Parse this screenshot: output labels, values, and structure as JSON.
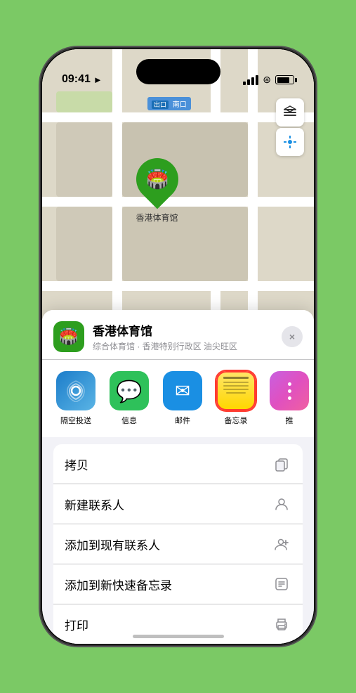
{
  "status_bar": {
    "time": "09:41",
    "location_arrow": "▶"
  },
  "map": {
    "label": "南口",
    "pin_label": "香港体育馆"
  },
  "venue": {
    "name": "香港体育馆",
    "subtitle": "综合体育馆 · 香港特别行政区 油尖旺区",
    "close_label": "×"
  },
  "share_items": [
    {
      "id": "airdrop",
      "label": "隔空投送",
      "icon": "📡"
    },
    {
      "id": "messages",
      "label": "信息",
      "icon": "💬"
    },
    {
      "id": "mail",
      "label": "邮件",
      "icon": "✉️"
    },
    {
      "id": "notes",
      "label": "备忘录",
      "icon": ""
    },
    {
      "id": "more",
      "label": "推",
      "icon": ""
    }
  ],
  "actions": [
    {
      "id": "copy",
      "label": "拷贝",
      "icon": "copy"
    },
    {
      "id": "new-contact",
      "label": "新建联系人",
      "icon": "person"
    },
    {
      "id": "add-contact",
      "label": "添加到现有联系人",
      "icon": "person-add"
    },
    {
      "id": "add-notes",
      "label": "添加到新快速备忘录",
      "icon": "notes-add"
    },
    {
      "id": "print",
      "label": "打印",
      "icon": "print"
    }
  ]
}
